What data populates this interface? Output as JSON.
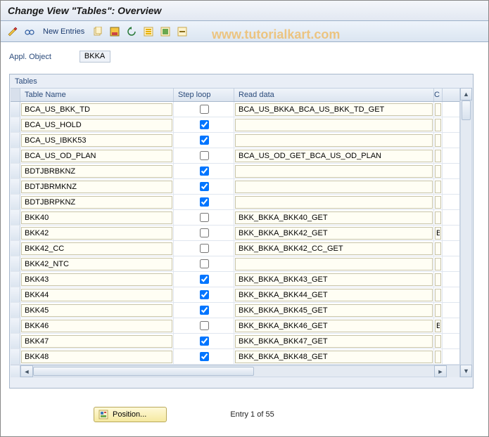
{
  "title": "Change View \"Tables\": Overview",
  "watermark": "www.tutorialkart.com",
  "toolbar": {
    "new_entries": "New Entries"
  },
  "field": {
    "label": "Appl. Object",
    "value": "BKKA"
  },
  "table": {
    "group_title": "Tables",
    "cols": {
      "name": "Table Name",
      "step": "Step loop",
      "read": "Read data",
      "c": "C"
    },
    "rows": [
      {
        "name": "BCA_US_BKK_TD",
        "step": false,
        "read": "BCA_US_BKKA_BCA_US_BKK_TD_GET",
        "c": ""
      },
      {
        "name": "BCA_US_HOLD",
        "step": true,
        "read": "",
        "c": ""
      },
      {
        "name": "BCA_US_IBKK53",
        "step": true,
        "read": "",
        "c": ""
      },
      {
        "name": "BCA_US_OD_PLAN",
        "step": false,
        "read": "BCA_US_OD_GET_BCA_US_OD_PLAN",
        "c": ""
      },
      {
        "name": "BDTJBRBKNZ",
        "step": true,
        "read": "",
        "c": ""
      },
      {
        "name": "BDTJBRMKNZ",
        "step": true,
        "read": "",
        "c": ""
      },
      {
        "name": "BDTJBRPKNZ",
        "step": true,
        "read": "",
        "c": ""
      },
      {
        "name": "BKK40",
        "step": false,
        "read": "BKK_BKKA_BKK40_GET",
        "c": ""
      },
      {
        "name": "BKK42",
        "step": false,
        "read": "BKK_BKKA_BKK42_GET",
        "c": "B"
      },
      {
        "name": "BKK42_CC",
        "step": false,
        "read": "BKK_BKKA_BKK42_CC_GET",
        "c": ""
      },
      {
        "name": "BKK42_NTC",
        "step": false,
        "read": "",
        "c": ""
      },
      {
        "name": "BKK43",
        "step": true,
        "read": "BKK_BKKA_BKK43_GET",
        "c": ""
      },
      {
        "name": "BKK44",
        "step": true,
        "read": "BKK_BKKA_BKK44_GET",
        "c": ""
      },
      {
        "name": "BKK45",
        "step": true,
        "read": "BKK_BKKA_BKK45_GET",
        "c": ""
      },
      {
        "name": "BKK46",
        "step": false,
        "read": "BKK_BKKA_BKK46_GET",
        "c": "B"
      },
      {
        "name": "BKK47",
        "step": true,
        "read": "BKK_BKKA_BKK47_GET",
        "c": ""
      },
      {
        "name": "BKK48",
        "step": true,
        "read": "BKK_BKKA_BKK48_GET",
        "c": ""
      }
    ]
  },
  "bottom": {
    "position_label": "Position...",
    "entry_text": "Entry 1 of 55"
  }
}
